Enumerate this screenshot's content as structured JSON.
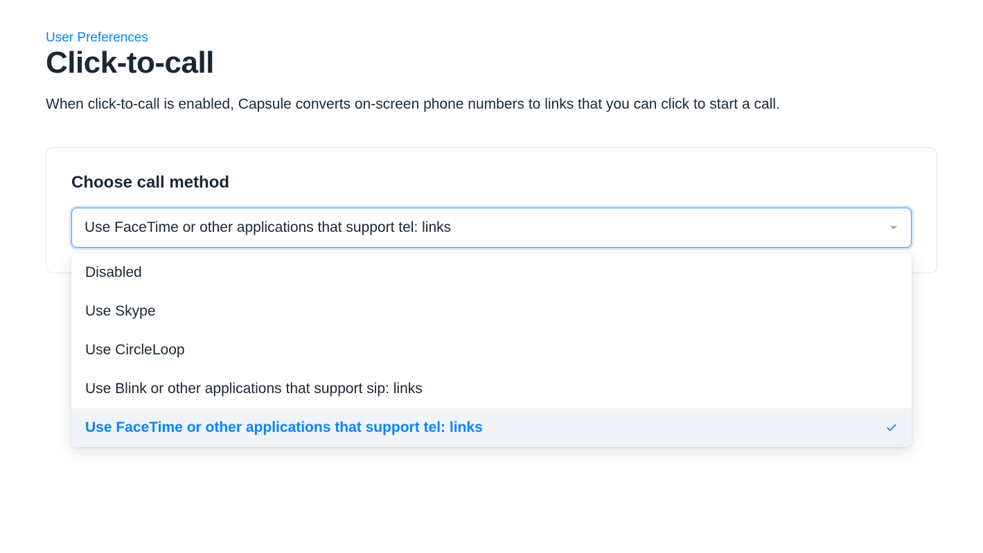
{
  "breadcrumb": "User Preferences",
  "title": "Click-to-call",
  "description": "When click-to-call is enabled, Capsule converts on-screen phone numbers to links that you can click to start a call.",
  "field": {
    "label": "Choose call method",
    "selected": "Use FaceTime or other applications that support tel: links",
    "options": [
      {
        "label": "Disabled",
        "selected": false
      },
      {
        "label": "Use Skype",
        "selected": false
      },
      {
        "label": "Use CircleLoop",
        "selected": false
      },
      {
        "label": "Use Blink or other applications that support sip: links",
        "selected": false
      },
      {
        "label": "Use FaceTime or other applications that support tel: links",
        "selected": true
      }
    ]
  },
  "colors": {
    "accent": "#0a84ff",
    "focusRing": "#3a9cff",
    "text": "#1a2735",
    "border": "#e3e5e8",
    "hoverBg": "#f0f4f8"
  }
}
